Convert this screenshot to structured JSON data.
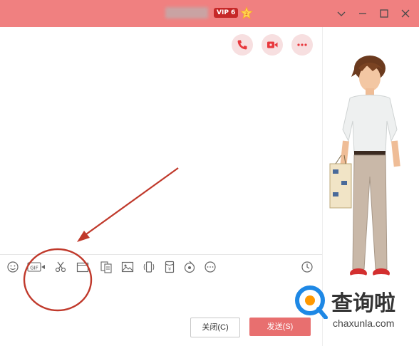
{
  "titlebar": {
    "contact_name": "",
    "vip_badge": "VIP 6",
    "crown_icon": "crown-icon",
    "window_controls": [
      "chevron-down-icon",
      "minimize-icon",
      "maximize-icon",
      "close-icon"
    ]
  },
  "call_buttons": [
    "phone-icon",
    "video-icon",
    "more-icon"
  ],
  "toolbar": {
    "tools": [
      "emoji-icon",
      "gif-icon",
      "screenshot-scissors-icon",
      "folder-icon",
      "doc-icon",
      "image-icon",
      "shake-icon",
      "redpacket-icon",
      "music-icon",
      "more-icon"
    ],
    "history_icon": "clock-icon",
    "gif_label": "GIF"
  },
  "buttons": {
    "close_label": "关闭(C)",
    "send_label": "发送(S)"
  },
  "watermark": {
    "brand": "查询啦",
    "url": "chaxunla.com"
  },
  "colors": {
    "title_bg": "#f08080",
    "send_bg": "#e86f6f",
    "accent": "#e33"
  }
}
